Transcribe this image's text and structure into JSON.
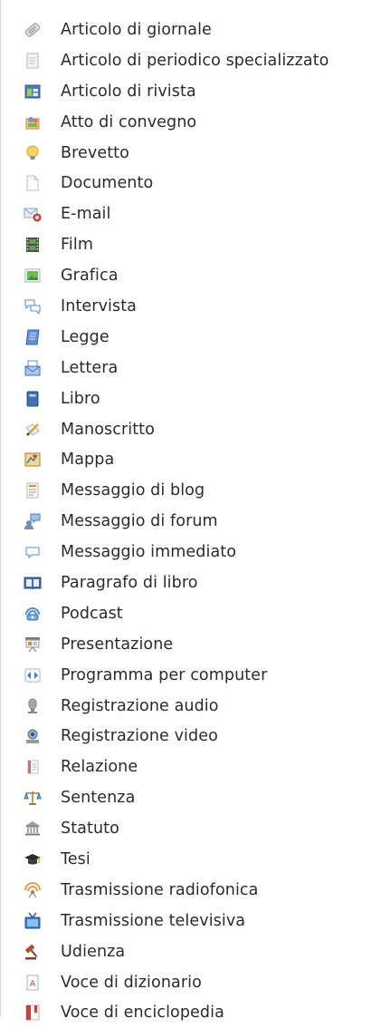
{
  "menu": {
    "items": [
      {
        "label": "Articolo di giornale",
        "icon": "newspaper-article-icon"
      },
      {
        "label": "Articolo di periodico specializzato",
        "icon": "journal-article-icon"
      },
      {
        "label": "Articolo di rivista",
        "icon": "magazine-article-icon"
      },
      {
        "label": "Atto di convegno",
        "icon": "conference-proceedings-icon"
      },
      {
        "label": "Brevetto",
        "icon": "patent-lightbulb-icon"
      },
      {
        "label": "Documento",
        "icon": "document-icon"
      },
      {
        "label": "E-mail",
        "icon": "email-icon"
      },
      {
        "label": "Film",
        "icon": "film-icon"
      },
      {
        "label": "Grafica",
        "icon": "graphic-image-icon"
      },
      {
        "label": "Intervista",
        "icon": "interview-speech-bubbles-icon"
      },
      {
        "label": "Legge",
        "icon": "law-book-icon"
      },
      {
        "label": "Lettera",
        "icon": "letter-icon"
      },
      {
        "label": "Libro",
        "icon": "book-icon"
      },
      {
        "label": "Manoscritto",
        "icon": "manuscript-pen-icon"
      },
      {
        "label": "Mappa",
        "icon": "map-icon"
      },
      {
        "label": "Messaggio di blog",
        "icon": "blog-post-icon"
      },
      {
        "label": "Messaggio di forum",
        "icon": "forum-post-icon"
      },
      {
        "label": "Messaggio immediato",
        "icon": "instant-message-icon"
      },
      {
        "label": "Paragrafo di libro",
        "icon": "book-section-icon"
      },
      {
        "label": "Podcast",
        "icon": "podcast-icon"
      },
      {
        "label": "Presentazione",
        "icon": "presentation-icon"
      },
      {
        "label": "Programma per computer",
        "icon": "computer-program-icon"
      },
      {
        "label": "Registrazione audio",
        "icon": "audio-recording-icon"
      },
      {
        "label": "Registrazione video",
        "icon": "video-recording-icon"
      },
      {
        "label": "Relazione",
        "icon": "report-icon"
      },
      {
        "label": "Sentenza",
        "icon": "scales-icon"
      },
      {
        "label": "Statuto",
        "icon": "statute-building-icon"
      },
      {
        "label": "Tesi",
        "icon": "graduation-cap-icon"
      },
      {
        "label": "Trasmissione radiofonica",
        "icon": "radio-broadcast-icon"
      },
      {
        "label": "Trasmissione televisiva",
        "icon": "tv-broadcast-icon"
      },
      {
        "label": "Udienza",
        "icon": "gavel-icon"
      },
      {
        "label": "Voce di dizionario",
        "icon": "dictionary-entry-icon"
      },
      {
        "label": "Voce di enciclopedia",
        "icon": "encyclopedia-entry-icon"
      }
    ]
  }
}
